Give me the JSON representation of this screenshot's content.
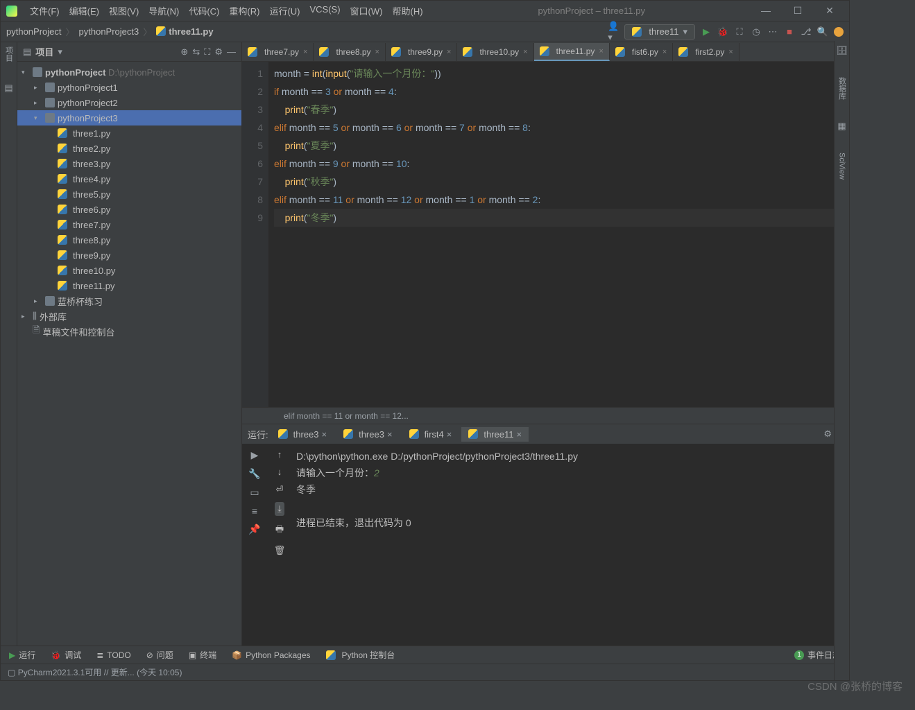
{
  "titlebar": {
    "app_title": "pythonProject – three11.py",
    "menus": [
      "文件(F)",
      "编辑(E)",
      "视图(V)",
      "导航(N)",
      "代码(C)",
      "重构(R)",
      "运行(U)",
      "VCS(S)",
      "窗口(W)",
      "帮助(H)"
    ]
  },
  "breadcrumbs": [
    "pythonProject",
    "pythonProject3",
    "three11.py"
  ],
  "run_config": "three11",
  "project_panel": {
    "title": "项目",
    "root": {
      "name": "pythonProject",
      "path": "D:\\pythonProject"
    },
    "subfolders": [
      "pythonProject1",
      "pythonProject2"
    ],
    "selected_folder": "pythonProject3",
    "files": [
      "three1.py",
      "three2.py",
      "three3.py",
      "three4.py",
      "three5.py",
      "three6.py",
      "three7.py",
      "three8.py",
      "three9.py",
      "three10.py",
      "three11.py"
    ],
    "other_nodes": [
      "蓝桥杯练习",
      "外部库",
      "草稿文件和控制台"
    ]
  },
  "editor_tabs": [
    "three7.py",
    "three8.py",
    "three9.py",
    "three10.py",
    "three11.py",
    "fist6.py",
    "first2.py"
  ],
  "editor_active_tab": "three11.py",
  "code": {
    "lines": [
      {
        "n": 1,
        "tokens": [
          [
            "id",
            "month"
          ],
          [
            "op",
            " = "
          ],
          [
            "fn",
            "int"
          ],
          [
            "op",
            "("
          ],
          [
            "fn",
            "input"
          ],
          [
            "op",
            "("
          ],
          [
            "str",
            "\"请输入一个月份：\""
          ],
          [
            "op",
            "))"
          ]
        ]
      },
      {
        "n": 2,
        "tokens": [
          [
            "kw",
            "if"
          ],
          [
            "id",
            " month "
          ],
          [
            "op",
            "== "
          ],
          [
            "num",
            "3"
          ],
          [
            "kw",
            " or "
          ],
          [
            "id",
            "month "
          ],
          [
            "op",
            "== "
          ],
          [
            "num",
            "4"
          ],
          [
            "op",
            ":"
          ]
        ]
      },
      {
        "n": 3,
        "tokens": [
          [
            "op",
            "    "
          ],
          [
            "fn",
            "print"
          ],
          [
            "op",
            "("
          ],
          [
            "str",
            "\"春季\""
          ],
          [
            "op",
            ")"
          ]
        ]
      },
      {
        "n": 4,
        "tokens": [
          [
            "kw",
            "elif"
          ],
          [
            "id",
            " month "
          ],
          [
            "op",
            "== "
          ],
          [
            "num",
            "5"
          ],
          [
            "kw",
            " or "
          ],
          [
            "id",
            "month "
          ],
          [
            "op",
            "== "
          ],
          [
            "num",
            "6"
          ],
          [
            "kw",
            " or "
          ],
          [
            "id",
            "month "
          ],
          [
            "op",
            "== "
          ],
          [
            "num",
            "7"
          ],
          [
            "kw",
            " or "
          ],
          [
            "id",
            "month "
          ],
          [
            "op",
            "== "
          ],
          [
            "num",
            "8"
          ],
          [
            "op",
            ":"
          ]
        ]
      },
      {
        "n": 5,
        "tokens": [
          [
            "op",
            "    "
          ],
          [
            "fn",
            "print"
          ],
          [
            "op",
            "("
          ],
          [
            "str",
            "\"夏季\""
          ],
          [
            "op",
            ")"
          ]
        ]
      },
      {
        "n": 6,
        "tokens": [
          [
            "kw",
            "elif"
          ],
          [
            "id",
            " month "
          ],
          [
            "op",
            "== "
          ],
          [
            "num",
            "9"
          ],
          [
            "kw",
            " or "
          ],
          [
            "id",
            "month "
          ],
          [
            "op",
            "== "
          ],
          [
            "num",
            "10"
          ],
          [
            "op",
            ":"
          ]
        ]
      },
      {
        "n": 7,
        "tokens": [
          [
            "op",
            "    "
          ],
          [
            "fn",
            "print"
          ],
          [
            "op",
            "("
          ],
          [
            "str",
            "\"秋季\""
          ],
          [
            "op",
            ")"
          ]
        ]
      },
      {
        "n": 8,
        "tokens": [
          [
            "kw",
            "elif"
          ],
          [
            "id",
            " month "
          ],
          [
            "op",
            "== "
          ],
          [
            "num",
            "11"
          ],
          [
            "kw",
            " or "
          ],
          [
            "id",
            "month "
          ],
          [
            "op",
            "== "
          ],
          [
            "num",
            "12"
          ],
          [
            "kw",
            " or "
          ],
          [
            "id",
            "month "
          ],
          [
            "op",
            "== "
          ],
          [
            "num",
            "1"
          ],
          [
            "kw",
            " or "
          ],
          [
            "id",
            "month "
          ],
          [
            "op",
            "== "
          ],
          [
            "num",
            "2"
          ],
          [
            "op",
            ":"
          ]
        ]
      },
      {
        "n": 9,
        "tokens": [
          [
            "op",
            "    "
          ],
          [
            "fn",
            "print"
          ],
          [
            "op",
            "("
          ],
          [
            "str",
            "\"冬季\""
          ],
          [
            "op",
            ")"
          ]
        ]
      }
    ],
    "crumb": "elif month == 11 or month == 12..."
  },
  "run": {
    "label": "运行:",
    "tabs": [
      "three3",
      "three3",
      "first4",
      "three11"
    ],
    "active_tab": "three11",
    "cmd": "D:\\python\\python.exe D:/pythonProject/pythonProject3/three11.py",
    "prompt": "请输入一个月份：",
    "input_echo": "2",
    "output": "冬季",
    "exit": "进程已结束，退出代码为 0"
  },
  "bottom_tabs": {
    "run": "运行",
    "debug": "调试",
    "todo": "TODO",
    "problems": "问题",
    "terminal": "终端",
    "pypkg": "Python Packages",
    "pyconsole": "Python 控制台",
    "eventlog": "事件日志",
    "evcount": "1"
  },
  "status": "PyCharm2021.3.1可用 // 更新... (今天 10:05)",
  "watermark": "CSDN @张桥的博客",
  "right_tools": [
    "数据库",
    "SciView"
  ]
}
